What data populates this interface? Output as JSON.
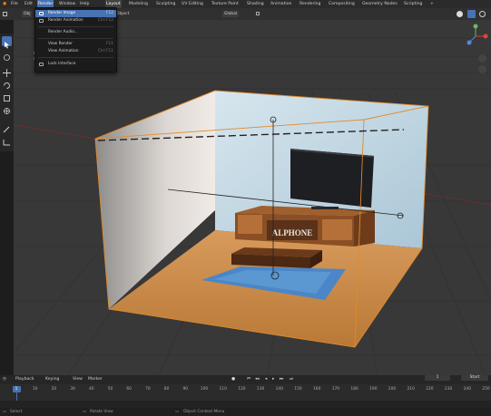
{
  "menubar": {
    "items": [
      "File",
      "Edit",
      "Render",
      "Window",
      "Help"
    ],
    "workspaces": [
      "Layout",
      "Modeling",
      "Sculpting",
      "UV Editing",
      "Texture Paint",
      "Shading",
      "Animation",
      "Rendering",
      "Compositing",
      "Geometry Nodes",
      "Scripting"
    ],
    "add_tab": "+"
  },
  "header": {
    "object_mode": "Obj",
    "object_menu": "Object",
    "transform_orientation": "Global"
  },
  "render_menu": {
    "items": [
      {
        "label": "Render Image",
        "shortcut": "F12"
      },
      {
        "label": "Render Animation",
        "shortcut": "Ctrl F12"
      },
      {
        "label": "Render Audio...",
        "shortcut": ""
      },
      {
        "label": "View Render",
        "shortcut": "F11"
      },
      {
        "label": "View Animation",
        "shortcut": "Ctrl F11"
      },
      {
        "label": "Lock Interface",
        "shortcut": ""
      }
    ]
  },
  "outliner": {
    "line1": "Came",
    "line2": "(1) C"
  },
  "scene": {
    "sign_text": "ALPHONE"
  },
  "timeline": {
    "menus": [
      "Playback",
      "Keying",
      "View",
      "Marker"
    ],
    "current_frame": "1",
    "start_label": "Start",
    "ruler_ticks": [
      1,
      10,
      20,
      30,
      40,
      50,
      60,
      70,
      80,
      90,
      100,
      110,
      120,
      130,
      140,
      150,
      160,
      170,
      180,
      190,
      200,
      210,
      220,
      230,
      240,
      250
    ]
  },
  "statusbar": {
    "select": "Select",
    "rotate": "Rotate View",
    "context": "Object Context Menu"
  },
  "colors": {
    "accent": "#4772b3",
    "selection_outline": "#e08a2a",
    "floor": "#c98a4e",
    "rug": "#4a86c8"
  }
}
